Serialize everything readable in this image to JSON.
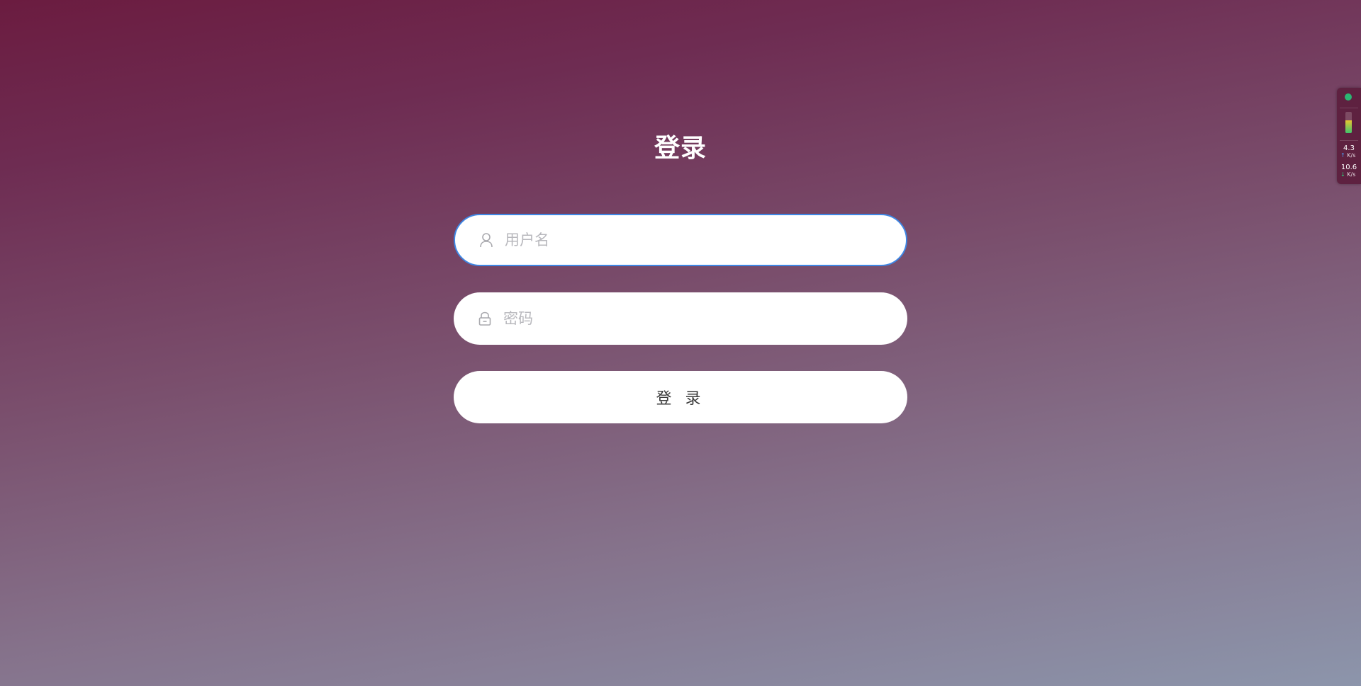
{
  "login": {
    "title": "登录",
    "username_placeholder": "用户名",
    "username_value": "",
    "password_placeholder": "密码",
    "password_value": "",
    "button_label": "登 录",
    "icons": {
      "username": "user-icon",
      "password": "lock-icon"
    },
    "colors": {
      "focus_border": "#3f87e4",
      "background_top": "#6b1c40",
      "background_bottom": "#8c95ab"
    }
  },
  "net_widget": {
    "status_color": "#2bb673",
    "upload_value": "4.3",
    "upload_unit": "K/s",
    "download_value": "10.6",
    "download_unit": "K/s"
  }
}
